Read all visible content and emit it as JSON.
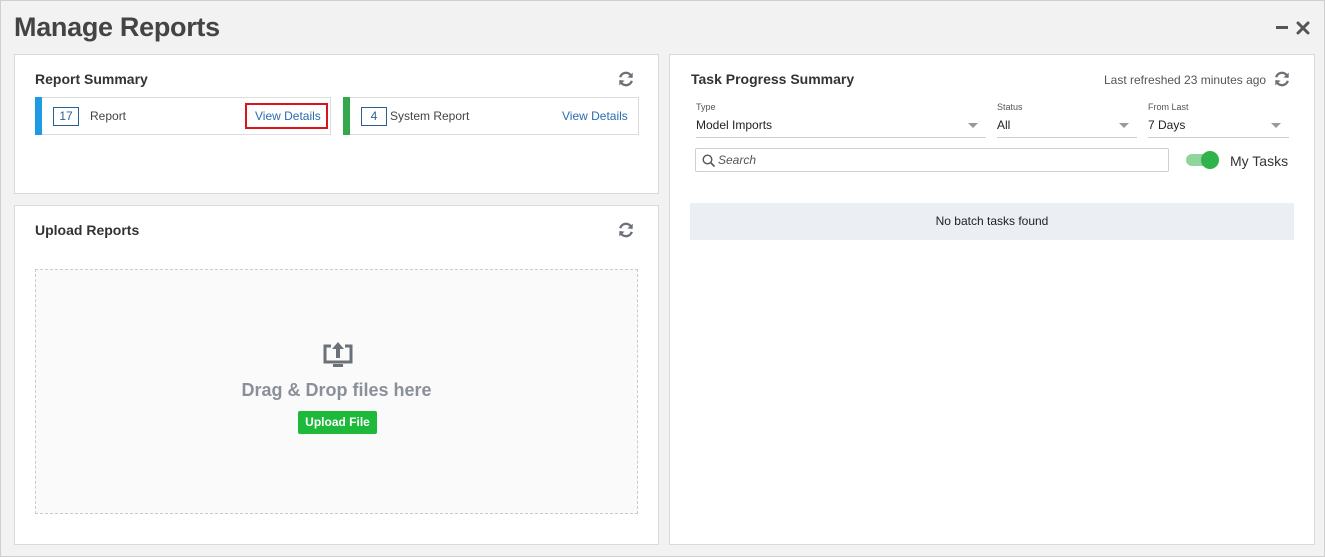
{
  "header": {
    "title": "Manage Reports"
  },
  "report_summary": {
    "title": "Report Summary",
    "cards": [
      {
        "count": "17",
        "label": "Report",
        "link": "View Details",
        "accent": "#1e9be3"
      },
      {
        "count": "4",
        "label": "System Report",
        "link": "View Details",
        "accent": "#36a84c"
      }
    ]
  },
  "upload_reports": {
    "title": "Upload Reports",
    "dropzone_text": "Drag & Drop files here",
    "button_label": "Upload File"
  },
  "task_progress": {
    "title": "Task Progress Summary",
    "last_refreshed": "Last refreshed 23 minutes ago",
    "filters": {
      "type": {
        "label": "Type",
        "value": "Model Imports"
      },
      "status": {
        "label": "Status",
        "value": "All"
      },
      "from_last": {
        "label": "From Last",
        "value": "7 Days"
      }
    },
    "search": {
      "placeholder": "Search",
      "value": ""
    },
    "my_tasks": {
      "label": "My Tasks",
      "enabled": true
    },
    "empty_message": "No batch tasks found"
  },
  "colors": {
    "link": "#2b6cb0",
    "upload_button": "#1db93a",
    "toggle_on": "#2fb34a",
    "highlight": "#d9141b"
  }
}
